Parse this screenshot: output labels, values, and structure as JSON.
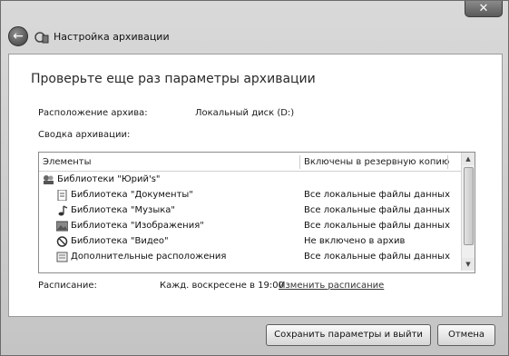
{
  "window": {
    "close_glyph": "✕"
  },
  "nav": {
    "back_glyph": "←",
    "title": "Настройка архивации",
    "back_icon": "back-arrow-icon",
    "wizard_icon": "backup-wizard-icon"
  },
  "main": {
    "heading": "Проверьте еще раз параметры архивации",
    "location_label": "Расположение архива:",
    "location_value": "Локальный диск (D:)",
    "summary_label": "Сводка архивации:",
    "schedule_label": "Расписание:",
    "schedule_value": "Кажд. воскресене в 19:00",
    "change_schedule": "Изменить расписание"
  },
  "table": {
    "columns": [
      "Элементы",
      "Включены в резервную копию"
    ],
    "rows": [
      {
        "name": "Библиотеки \"Юрий's\"",
        "status": "",
        "icon": "libraries-icon"
      },
      {
        "name": "Библиотека \"Документы\"",
        "status": "Все локальные файлы данных",
        "icon": "documents-icon"
      },
      {
        "name": "Библиотека \"Музыка\"",
        "status": "Все локальные файлы данных",
        "icon": "music-icon"
      },
      {
        "name": "Библиотека \"Изображения\"",
        "status": "Все локальные файлы данных",
        "icon": "pictures-icon"
      },
      {
        "name": "Библиотека \"Видео\"",
        "status": "Не включено в архив",
        "icon": "excluded-icon"
      },
      {
        "name": "Дополнительные расположения",
        "status": "Все локальные файлы данных",
        "icon": "folder-icon"
      }
    ]
  },
  "buttons": {
    "save": "Сохранить параметры и выйти",
    "cancel": "Отмена"
  }
}
